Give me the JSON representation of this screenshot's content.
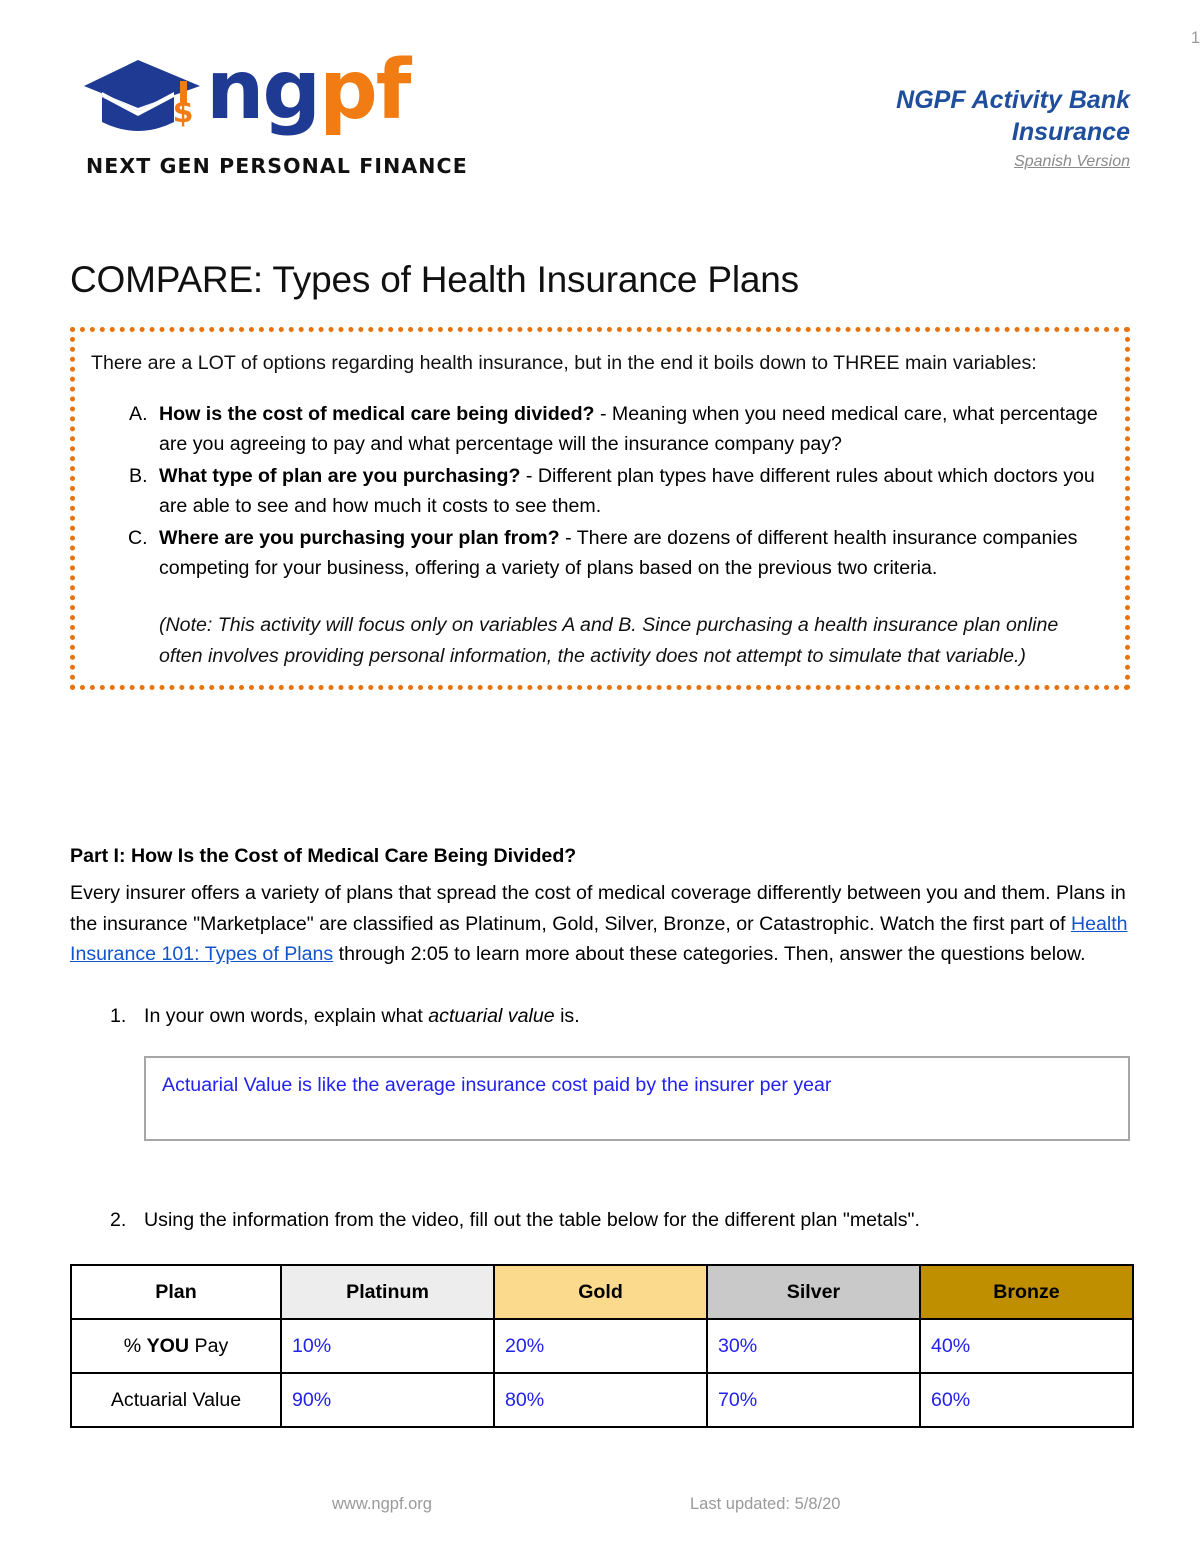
{
  "header": {
    "logo": {
      "wordmark_blue": "ng",
      "wordmark_orange": "pf",
      "tagline": "NEXT GEN PERSONAL FINANCE",
      "cap_icon": "graduation-cap-icon",
      "dollar_icon": "dollar-tassel-icon"
    },
    "activity_bank_line1": "NGPF Activity Bank",
    "activity_bank_line2": "Insurance",
    "version_link": "Spanish Version"
  },
  "title": "COMPARE: Types of Health Insurance Plans",
  "intro": {
    "lead": "There are a LOT of options regarding health insurance, but in the end it boils down to THREE main variables:",
    "items": [
      {
        "bold": "How is the cost of medical care being divided?",
        "rest": " - Meaning when you need medical care, what percentage are you agreeing to pay and what percentage will the insurance company pay?"
      },
      {
        "bold": "What type of plan are you purchasing?",
        "rest": " - Different plan types have different rules about which doctors you are able to see and how much it costs to see them."
      },
      {
        "bold": "Where are you purchasing your plan from?",
        "rest": " - There are dozens of different health insurance companies competing for your business, offering a variety of plans based on the previous two criteria."
      }
    ],
    "note": "(Note: This activity will focus only on variables A and B. Since purchasing a health insurance plan online often involves providing personal information, the activity does not attempt to simulate that variable.)",
    "border_color": "#E8730C"
  },
  "part1": {
    "heading": "Part I: How Is the Cost of Medical Care Being Divided?",
    "body_before_link": "Every insurer offers a variety of plans that spread the cost of medical coverage differently between you and them. Plans in the insurance \"Marketplace\" are classified as Platinum, Gold, Silver, Bronze, or Catastrophic. Watch the first part of ",
    "link_text": "Health Insurance 101: Types of Plans",
    "body_after_link": " through 2:05 to learn more about these categories. Then, answer the questions below."
  },
  "questions": [
    {
      "number": "1.",
      "text_before_italic": "In your own words, explain what ",
      "italic": "actuarial value",
      "text_after_italic": " is.",
      "answer": "Actuarial Value is like the average insurance cost paid by the insurer  per year"
    },
    {
      "number": "2.",
      "text": "Using the information from the video, fill out the table below for the different plan \"metals\"."
    }
  ],
  "table": {
    "headers": [
      "Plan",
      "Platinum",
      "Gold",
      "Silver",
      "Bronze"
    ],
    "header_colors": [
      "#FFFFFF",
      "#EDEDED",
      "#FBDA8E",
      "#C9C9C9",
      "#BF8F00"
    ],
    "rows": [
      {
        "label_prefix": "% ",
        "label_bold": "YOU",
        "label_suffix": " Pay",
        "values": [
          "10%",
          "20%",
          "30%",
          "40%"
        ]
      },
      {
        "label_prefix": "Actuarial Value",
        "label_bold": "",
        "label_suffix": "",
        "values": [
          "90%",
          "80%",
          "70%",
          "60%"
        ]
      }
    ],
    "answer_color": "#2222EE"
  },
  "footer": {
    "site": "www.ngpf.org",
    "updated": "Last updated: 5/8/20",
    "page_number": "1"
  }
}
